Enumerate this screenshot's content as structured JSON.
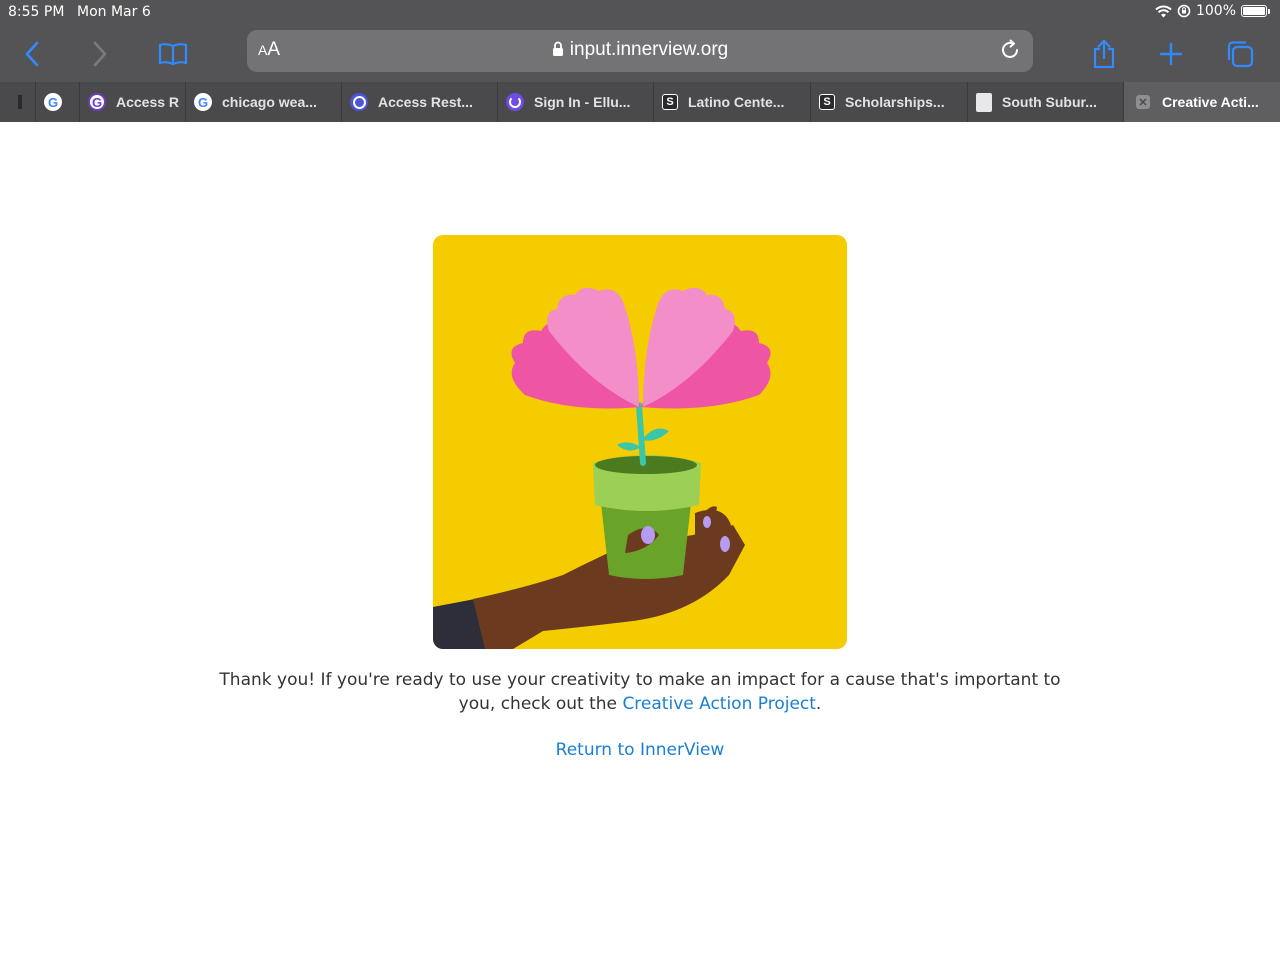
{
  "status_bar": {
    "time": "8:55 PM",
    "date": "Mon Mar 6",
    "battery": "100%"
  },
  "toolbar": {
    "aa_small": "A",
    "aa_big": "A",
    "url": "input.innerview.org",
    "icons": [
      "back-icon",
      "forward-icon",
      "bookmarks-icon",
      "share-icon",
      "new-tab-icon",
      "tabs-overview-icon"
    ]
  },
  "tabs": [
    {
      "label": "",
      "favicon": "partial"
    },
    {
      "label": "",
      "favicon": "google"
    },
    {
      "label": "Access R",
      "favicon": "g"
    },
    {
      "label": "chicago wea...",
      "favicon": "google"
    },
    {
      "label": "Access Rest...",
      "favicon": "q"
    },
    {
      "label": "Sign In - Ellu...",
      "favicon": "u"
    },
    {
      "label": "Latino Cente...",
      "favicon": "s"
    },
    {
      "label": "Scholarships...",
      "favicon": "s"
    },
    {
      "label": "South Subur...",
      "favicon": "doc"
    },
    {
      "label": "Creative Acti...",
      "favicon": "close",
      "active": true
    }
  ],
  "page": {
    "message_before": "Thank you! If you're ready to use your creativity to make an impact for a cause that's important to you, check out the ",
    "message_link": "Creative Action Project",
    "message_after": ".",
    "return_link": "Return to InnerView"
  },
  "colors": {
    "chrome": "#545456",
    "hero_bg": "#f5cc00",
    "link": "#1a7fd4",
    "petal_dark": "#ef55a5",
    "petal_light": "#f48ec9",
    "pot": "#7fb83a",
    "skin": "#6b3a1f"
  }
}
